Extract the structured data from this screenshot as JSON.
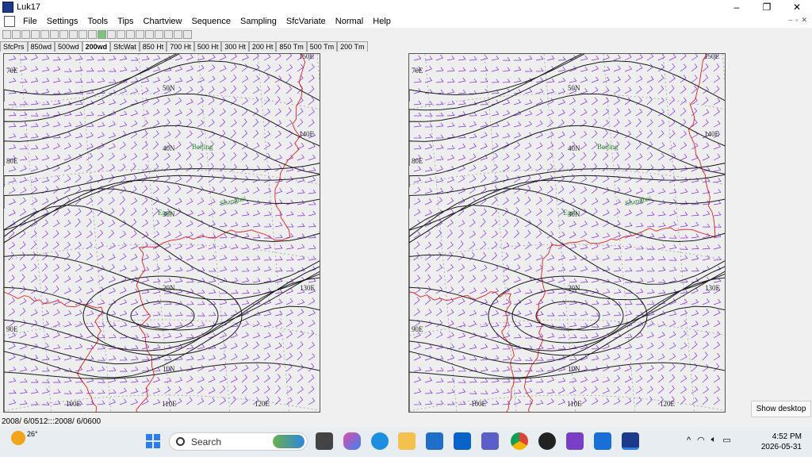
{
  "window": {
    "title": "Luk17",
    "minimize": "–",
    "maximize": "❐",
    "close": "✕"
  },
  "menu": [
    "File",
    "Settings",
    "Tools",
    "Tips",
    "Chartview",
    "Sequence",
    "Sampling",
    "SfcVariate",
    "Normal",
    "Help"
  ],
  "mdi_controls": {
    "minimize": "–",
    "restore": "▫",
    "close": "✕"
  },
  "toolbar_icons": [
    "new-icon",
    "open-icon",
    "save-icon",
    "first-icon",
    "prev-icon",
    "back-icon",
    "stop-icon",
    "play-icon",
    "step-icon",
    "fast-forward-icon",
    "globe-icon",
    "upload-icon",
    "grid-icon",
    "rotate-icon",
    "zoom-icon",
    "dual-view-icon",
    "cursor-icon",
    "layout-icon",
    "print-icon",
    "settings-icon"
  ],
  "tabs": [
    {
      "label": "SfcPrs",
      "active": false
    },
    {
      "label": "850wd",
      "active": false
    },
    {
      "label": "500wd",
      "active": false
    },
    {
      "label": "200wd",
      "active": true
    },
    {
      "label": "SfcWat",
      "active": false
    },
    {
      "label": "850 Ht",
      "active": false
    },
    {
      "label": "700 Ht",
      "active": false
    },
    {
      "label": "500 Ht",
      "active": false
    },
    {
      "label": "300 Ht",
      "active": false
    },
    {
      "label": "200 Ht",
      "active": false
    },
    {
      "label": "850 Tm",
      "active": false
    },
    {
      "label": "500 Tm",
      "active": false
    },
    {
      "label": "200 Tm",
      "active": false
    }
  ],
  "map": {
    "lon_labels": [
      "150E",
      "140E",
      "130E",
      "120E",
      "110E",
      "100E",
      "90E",
      "80E",
      "70E"
    ],
    "lat_labels": [
      "50N",
      "40N",
      "30N",
      "20N",
      "10N"
    ],
    "cities": [
      "Beijing",
      "Shanghai",
      "Easti"
    ],
    "colors": {
      "contour": "#1a1a1a",
      "wind": "#7a2be2",
      "coast": "#e02020",
      "grid": "#888888",
      "city": "#2a8a2a"
    }
  },
  "status": "2008/ 6/0512:::2008/ 6/0600",
  "show_desktop": "Show desktop",
  "taskbar": {
    "weather_temp": "26°",
    "search_placeholder": "Search",
    "time": "4:52 PM",
    "date": "2026-05-31",
    "tray": [
      "^",
      "wifi",
      "volume",
      "battery"
    ]
  }
}
